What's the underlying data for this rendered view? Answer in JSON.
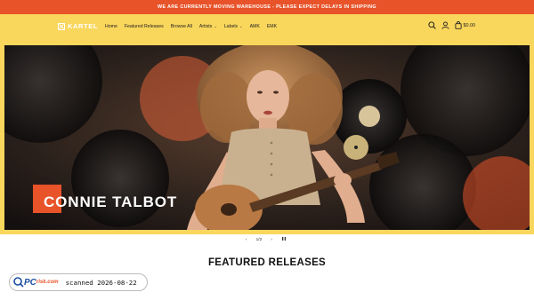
{
  "announcement": "WE ARE CURRENTLY MOVING WAREHOUSE - PLEASE EXPECT DELAYS IN SHIPPING",
  "header": {
    "logo_text": "KARTEL",
    "nav": [
      "Home",
      "Featured Releases",
      "Browse All",
      "Artists",
      "Labels",
      "AMK",
      "EMK"
    ],
    "nav_dropdown_icon": "chevron-down-icon",
    "cart_total": "$0.00"
  },
  "hero": {
    "title": "CONNIE TALBOT",
    "image_description": "Woman with curly hair lying on vinyl records holding a guitar"
  },
  "slider": {
    "counter": "1/2"
  },
  "featured": {
    "title": "FEATURED RELEASES"
  },
  "watermark": {
    "brand": "PC",
    "brand_small": "risk.com",
    "text": "scanned 2026-08-22"
  },
  "colors": {
    "accent": "#e8532a",
    "header_bg": "#f9d65c"
  }
}
